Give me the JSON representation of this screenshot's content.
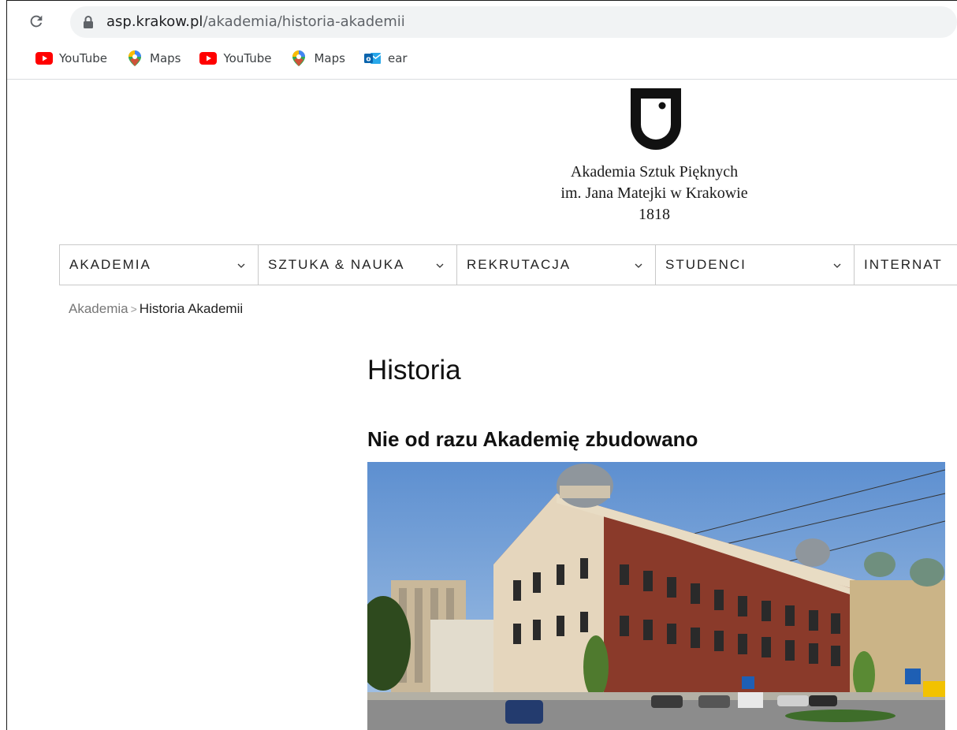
{
  "browser": {
    "url_host": "asp.krakow.pl",
    "url_path": "/akademia/historia-akademii",
    "bookmarks": [
      {
        "label": "YouTube",
        "icon": "youtube-icon"
      },
      {
        "label": "Maps",
        "icon": "maps-icon"
      },
      {
        "label": "YouTube",
        "icon": "youtube-icon"
      },
      {
        "label": "Maps",
        "icon": "maps-icon"
      },
      {
        "label": "ear",
        "icon": "outlook-icon"
      }
    ]
  },
  "site": {
    "name_line1": "Akademia Sztuk Pięknych",
    "name_line2": "im. Jana Matejki w Krakowie",
    "year": "1818"
  },
  "nav": {
    "items": [
      "AKADEMIA",
      "SZTUKA & NAUKA",
      "REKRUTACJA",
      "STUDENCI",
      "INTERNAT"
    ]
  },
  "breadcrumb": {
    "parent": "Akademia",
    "separator": ">",
    "current": "Historia Akademii"
  },
  "page": {
    "title": "Historia",
    "subtitle": "Nie od razu Akademię zbudowano"
  },
  "colors": {
    "youtube_red": "#ff0000",
    "sky": "#7fa7d6",
    "brick": "#8a3a2a"
  }
}
